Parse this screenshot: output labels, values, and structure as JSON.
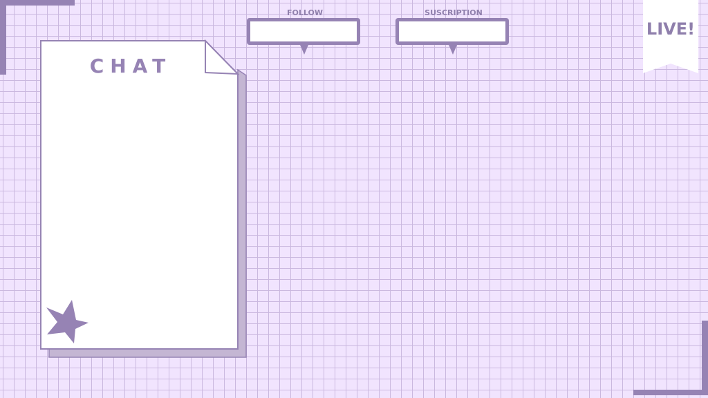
{
  "chat": {
    "title": "CHAT"
  },
  "widgets": {
    "follow": {
      "label": "FOLLOW",
      "value": ""
    },
    "subscription": {
      "label": "SUSCRIPTION",
      "value": ""
    }
  },
  "live_banner": {
    "text": "LIVE!"
  },
  "colors": {
    "background": "#f1e4fe",
    "grid_line": "#cab8df",
    "accent": "#9683b4",
    "panel": "#ffffff",
    "panel_shadow": "#c4b6d3"
  },
  "icons": {
    "chat_decoration": "star-icon"
  }
}
